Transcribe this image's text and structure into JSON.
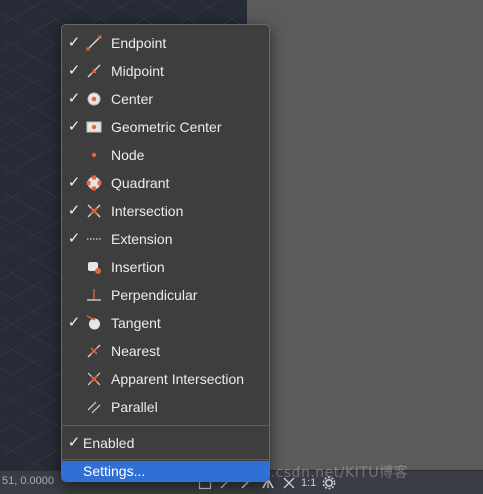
{
  "menu": {
    "items": [
      {
        "label": "Endpoint",
        "checked": "✓",
        "icon": "endpoint-snap-icon"
      },
      {
        "label": "Midpoint",
        "checked": "✓",
        "icon": "midpoint-snap-icon"
      },
      {
        "label": "Center",
        "checked": "✓",
        "icon": "center-snap-icon"
      },
      {
        "label": "Geometric Center",
        "checked": "✓",
        "icon": "geometric-center-snap-icon"
      },
      {
        "label": "Node",
        "checked": "",
        "icon": "node-snap-icon"
      },
      {
        "label": "Quadrant",
        "checked": "✓",
        "icon": "quadrant-snap-icon"
      },
      {
        "label": "Intersection",
        "checked": "✓",
        "icon": "intersection-snap-icon"
      },
      {
        "label": "Extension",
        "checked": "✓",
        "icon": "extension-snap-icon"
      },
      {
        "label": "Insertion",
        "checked": "",
        "icon": "insertion-snap-icon"
      },
      {
        "label": "Perpendicular",
        "checked": "",
        "icon": "perpendicular-snap-icon"
      },
      {
        "label": "Tangent",
        "checked": "✓",
        "icon": "tangent-snap-icon"
      },
      {
        "label": "Nearest",
        "checked": "",
        "icon": "nearest-snap-icon"
      },
      {
        "label": "Apparent Intersection",
        "checked": "",
        "icon": "apparent-intersection-snap-icon"
      },
      {
        "label": "Parallel",
        "checked": "",
        "icon": "parallel-snap-icon"
      }
    ],
    "enabled": {
      "label": "Enabled",
      "checked": "✓"
    },
    "settings": {
      "label": "Settings..."
    }
  },
  "statusbar": {
    "coords": "51, 0.0000",
    "scale": "1:1",
    "icons": [
      "grid-icon",
      "snap-toggle-icon",
      "osnap-icon",
      "annotation-icon",
      "workspace-icon",
      "settings-gear-icon"
    ]
  },
  "watermark": "http://blog.csdn.net/KITU博客",
  "colors": {
    "accent": "#2f6fd6",
    "snap_marker": "#e8643c",
    "menu_bg": "#3e3e3f",
    "canvas_bg": "#262b35"
  }
}
